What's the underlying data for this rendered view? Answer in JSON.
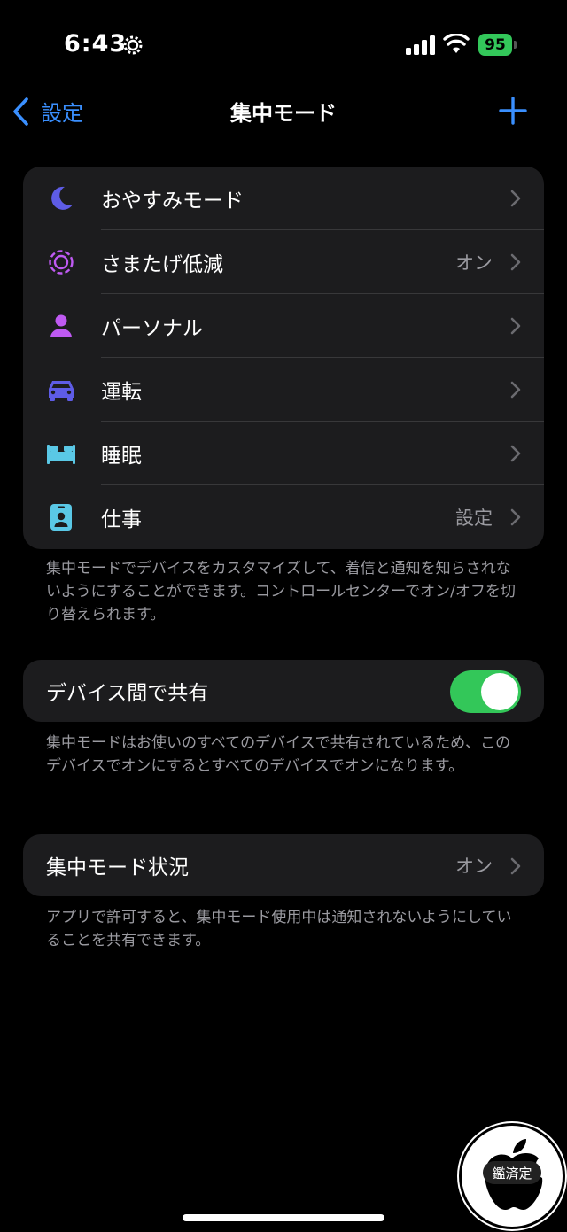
{
  "status_bar": {
    "time": "6:43",
    "battery": "95"
  },
  "nav": {
    "back_label": "設定",
    "title": "集中モード"
  },
  "modes": [
    {
      "label": "おやすみモード",
      "value": "",
      "icon": "moon-icon",
      "color": "#5e5ce6"
    },
    {
      "label": "さまたげ低減",
      "value": "オン",
      "icon": "reduce-interruptions-icon",
      "color": "#bf5af2"
    },
    {
      "label": "パーソナル",
      "value": "",
      "icon": "person-icon",
      "color": "#bf5af2"
    },
    {
      "label": "運転",
      "value": "",
      "icon": "car-icon",
      "color": "#5e5ce6"
    },
    {
      "label": "睡眠",
      "value": "",
      "icon": "bed-icon",
      "color": "#5ac8e6"
    },
    {
      "label": "仕事",
      "value": "設定",
      "icon": "id-badge-icon",
      "color": "#5ac8e6"
    }
  ],
  "modes_footer": "集中モードでデバイスをカスタマイズして、着信と通知を知らされないようにすることができます。コントロールセンターでオン/オフを切り替えられます。",
  "share": {
    "label": "デバイス間で共有",
    "on": true
  },
  "share_footer": "集中モードはお使いのすべてのデバイスで共有されているため、このデバイスでオンにするとすべてのデバイスでオンになります。",
  "status": {
    "label": "集中モード状況",
    "value": "オン"
  },
  "status_footer": "アプリで許可すると、集中モード使用中は通知されないようにしていることを共有できます。",
  "watermark": {
    "text": "鑑済定"
  },
  "colors": {
    "accent": "#3a8ffe",
    "toggle_on": "#33c759",
    "cell_bg": "#1c1c1e"
  }
}
